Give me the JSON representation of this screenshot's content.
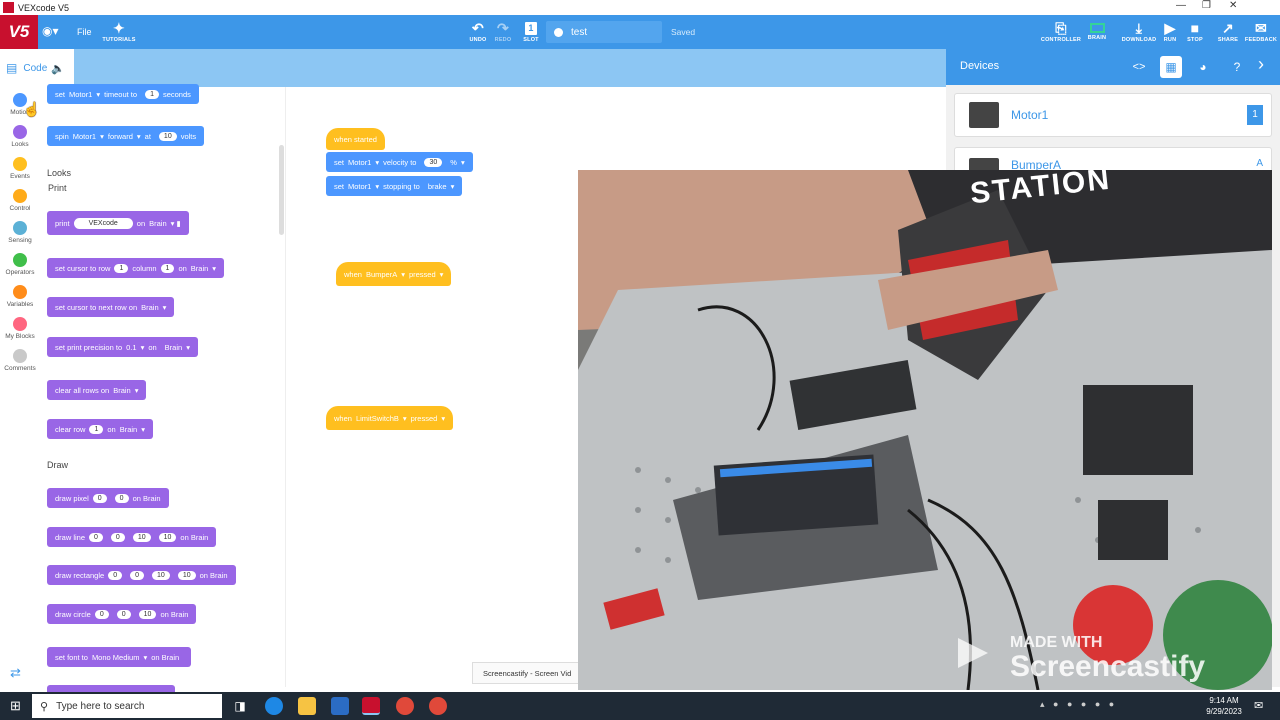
{
  "window": {
    "title": "VEXcode V5"
  },
  "menubar": {
    "logo": "V5",
    "file": "File",
    "tutorials": "TUTORIALS",
    "undo": "UNDO",
    "redo": "REDO",
    "slot": "SLOT",
    "project_name": "test",
    "status": "Saved",
    "controller": "CONTROLLER",
    "brain": "BRAIN",
    "download": "DOWNLOAD",
    "run": "RUN",
    "stop": "STOP",
    "share": "SHARE",
    "feedback": "FEEDBACK"
  },
  "code_tab": {
    "label": "Code"
  },
  "categories": [
    {
      "label": "Motion",
      "color": "#4c97ff"
    },
    {
      "label": "Looks",
      "color": "#9966e6"
    },
    {
      "label": "Events",
      "color": "#ffbf1f"
    },
    {
      "label": "Control",
      "color": "#ffab19"
    },
    {
      "label": "Sensing",
      "color": "#5cb1d6"
    },
    {
      "label": "Operators",
      "color": "#40bf4a"
    },
    {
      "label": "Variables",
      "color": "#ff8c1a"
    },
    {
      "label": "My Blocks",
      "color": "#ff6680"
    },
    {
      "label": "Comments",
      "color": "#c9c9c9"
    }
  ],
  "palette": {
    "motion_blocks": {
      "timeout": {
        "a": "set",
        "b": "Motor1",
        "c": "timeout to",
        "d": "1",
        "e": "seconds"
      },
      "spin": {
        "a": "spin",
        "b": "Motor1",
        "c": "forward",
        "d": "at",
        "e": "10",
        "f": "volts"
      }
    },
    "looks_header": "Looks",
    "print_header": "Print",
    "print": {
      "a": "print",
      "b": "VEXcode",
      "c": "on",
      "d": "Brain"
    },
    "set_cursor": {
      "a": "set cursor to row",
      "b": "1",
      "c": "column",
      "d": "1",
      "e": "on",
      "f": "Brain"
    },
    "next_row": {
      "a": "set cursor to next row on",
      "b": "Brain"
    },
    "precision": {
      "a": "set print precision to",
      "b": "0.1",
      "c": "on",
      "d": "Brain"
    },
    "clear_all": {
      "a": "clear all rows on",
      "b": "Brain"
    },
    "clear_row": {
      "a": "clear row",
      "b": "1",
      "c": "on",
      "d": "Brain"
    },
    "draw_header": "Draw",
    "draw_pixel": {
      "a": "draw pixel",
      "b": "0",
      "c": "0",
      "d": "on Brain"
    },
    "draw_line": {
      "a": "draw line",
      "b": "0",
      "c": "0",
      "d": "10",
      "e": "10",
      "f": "on Brain"
    },
    "draw_rect": {
      "a": "draw rectangle",
      "b": "0",
      "c": "0",
      "d": "10",
      "e": "10",
      "f": "on Brain"
    },
    "draw_circle": {
      "a": "draw circle",
      "b": "0",
      "c": "0",
      "d": "10",
      "e": "on Brain"
    },
    "set_font": {
      "a": "set font to",
      "b": "Mono Medium",
      "c": "on Brain"
    }
  },
  "workspace": {
    "when_started": "when started",
    "velocity": {
      "a": "set",
      "b": "Motor1",
      "c": "velocity to",
      "d": "30",
      "e": "%"
    },
    "stopping": {
      "a": "set",
      "b": "Motor1",
      "c": "stopping to",
      "d": "brake"
    },
    "bumper": {
      "a": "when",
      "b": "BumperA",
      "c": "pressed"
    },
    "limit": {
      "a": "when",
      "b": "LimitSwitchB",
      "c": "pressed"
    }
  },
  "devices": {
    "title": "Devices",
    "items": [
      {
        "name": "Motor1",
        "port": "1"
      },
      {
        "name": "BumperA",
        "port": "A"
      }
    ]
  },
  "webcam": {
    "watermark_line1": "MADE WITH",
    "watermark_line2": "Screencastify",
    "screencastify_tab": "Screencastify - Screen Vid",
    "shirt_text": "STATION"
  },
  "taskbar": {
    "search_placeholder": "Type here to search",
    "time": "9:14 AM",
    "date": "9/29/2023"
  }
}
